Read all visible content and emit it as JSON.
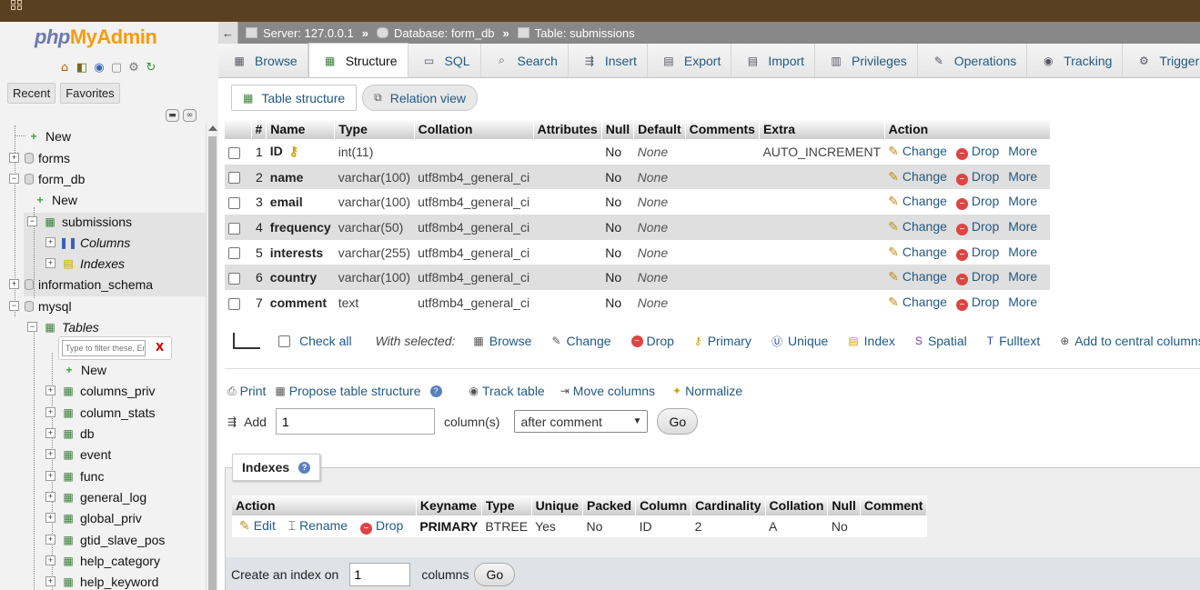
{
  "logo": {
    "php": "php",
    "myadmin": "MyAdmin"
  },
  "sidebar": {
    "tabs": [
      "Recent",
      "Favorites"
    ],
    "filter_placeholder": "Type to filter these, Enter to search all",
    "tree": [
      {
        "label": "New"
      },
      {
        "label": "forms"
      },
      {
        "label": "form_db"
      },
      {
        "label": "New"
      },
      {
        "label": "submissions"
      },
      {
        "label": "Columns"
      },
      {
        "label": "Indexes"
      },
      {
        "label": "information_schema"
      },
      {
        "label": "mysql"
      },
      {
        "label": "Tables"
      },
      {
        "label": "New"
      },
      {
        "label": "columns_priv"
      },
      {
        "label": "column_stats"
      },
      {
        "label": "db"
      },
      {
        "label": "event"
      },
      {
        "label": "func"
      },
      {
        "label": "general_log"
      },
      {
        "label": "global_priv"
      },
      {
        "label": "gtid_slave_pos"
      },
      {
        "label": "help_category"
      },
      {
        "label": "help_keyword"
      }
    ]
  },
  "breadcrumb": {
    "server": "Server: 127.0.0.1",
    "database": "Database: form_db",
    "table": "Table: submissions",
    "sep": "»"
  },
  "tabs": [
    "Browse",
    "Structure",
    "SQL",
    "Search",
    "Insert",
    "Export",
    "Import",
    "Privileges",
    "Operations",
    "Tracking",
    "Triggers"
  ],
  "active_tab": "Structure",
  "subtabs": [
    "Table structure",
    "Relation view"
  ],
  "structure": {
    "headers": [
      "#",
      "Name",
      "Type",
      "Collation",
      "Attributes",
      "Null",
      "Default",
      "Comments",
      "Extra",
      "Action"
    ],
    "rows": [
      {
        "num": "1",
        "name": "ID",
        "type": "int(11)",
        "collation": "",
        "null": "No",
        "default": "None",
        "extra": "AUTO_INCREMENT"
      },
      {
        "num": "2",
        "name": "name",
        "type": "varchar(100)",
        "collation": "utf8mb4_general_ci",
        "null": "No",
        "default": "None",
        "extra": ""
      },
      {
        "num": "3",
        "name": "email",
        "type": "varchar(100)",
        "collation": "utf8mb4_general_ci",
        "null": "No",
        "default": "None",
        "extra": ""
      },
      {
        "num": "4",
        "name": "frequency",
        "type": "varchar(50)",
        "collation": "utf8mb4_general_ci",
        "null": "No",
        "default": "None",
        "extra": ""
      },
      {
        "num": "5",
        "name": "interests",
        "type": "varchar(255)",
        "collation": "utf8mb4_general_ci",
        "null": "No",
        "default": "None",
        "extra": ""
      },
      {
        "num": "6",
        "name": "country",
        "type": "varchar(100)",
        "collation": "utf8mb4_general_ci",
        "null": "No",
        "default": "None",
        "extra": ""
      },
      {
        "num": "7",
        "name": "comment",
        "type": "text",
        "collation": "utf8mb4_general_ci",
        "null": "No",
        "default": "None",
        "extra": ""
      }
    ],
    "actions": {
      "change": "Change",
      "drop": "Drop",
      "more": "More"
    }
  },
  "with_selected": {
    "check_all": "Check all",
    "label": "With selected:",
    "actions": [
      "Browse",
      "Change",
      "Drop",
      "Primary",
      "Unique",
      "Index",
      "Spatial",
      "Fulltext",
      "Add to central columns"
    ]
  },
  "tools": {
    "print": "Print",
    "propose": "Propose table structure",
    "track": "Track table",
    "move": "Move columns",
    "normalize": "Normalize"
  },
  "add_columns": {
    "label": "Add",
    "value": "1",
    "unit": "column(s)",
    "position": "after comment",
    "go": "Go"
  },
  "indexes": {
    "title": "Indexes",
    "headers": [
      "Action",
      "Keyname",
      "Type",
      "Unique",
      "Packed",
      "Column",
      "Cardinality",
      "Collation",
      "Null",
      "Comment"
    ],
    "actions": {
      "edit": "Edit",
      "rename": "Rename",
      "drop": "Drop"
    },
    "row": {
      "keyname": "PRIMARY",
      "type": "BTREE",
      "unique": "Yes",
      "packed": "No",
      "column": "ID",
      "cardinality": "2",
      "collation": "A",
      "null": "No",
      "comment": ""
    },
    "create_label": "Create an index on",
    "create_value": "1",
    "create_unit": "columns",
    "go": "Go"
  }
}
